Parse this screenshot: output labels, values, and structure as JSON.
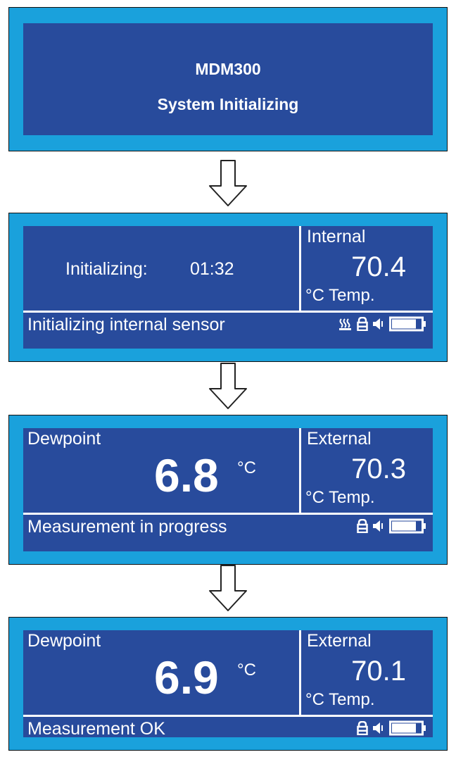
{
  "screens": [
    {
      "model": "MDM300",
      "status": "System Initializing"
    },
    {
      "left_label": "Initializing:",
      "left_time": "01:32",
      "right_label": "Internal",
      "right_value": "70.4",
      "right_unit": "°C Temp.",
      "status_text": "Initializing internal sensor",
      "icons": [
        "heater-icon",
        "lock-icon",
        "speaker-icon",
        "battery-icon"
      ]
    },
    {
      "left_label": "Dewpoint",
      "dewpoint_value": "6.8",
      "dewpoint_unit": "°C",
      "right_label": "External",
      "right_value": "70.3",
      "right_unit": "°C Temp.",
      "status_text": "Measurement in progress",
      "icons": [
        "lock-icon",
        "speaker-icon",
        "battery-icon"
      ]
    },
    {
      "left_label": "Dewpoint",
      "dewpoint_value": "6.9",
      "dewpoint_unit": "°C",
      "right_label": "External",
      "right_value": "70.1",
      "right_unit": "°C Temp.",
      "status_text": "Measurement OK",
      "icons": [
        "lock-icon",
        "speaker-icon",
        "battery-icon"
      ]
    }
  ],
  "colors": {
    "frame": "#1aa1dc",
    "display": "#284b9c",
    "text": "#ffffff"
  }
}
